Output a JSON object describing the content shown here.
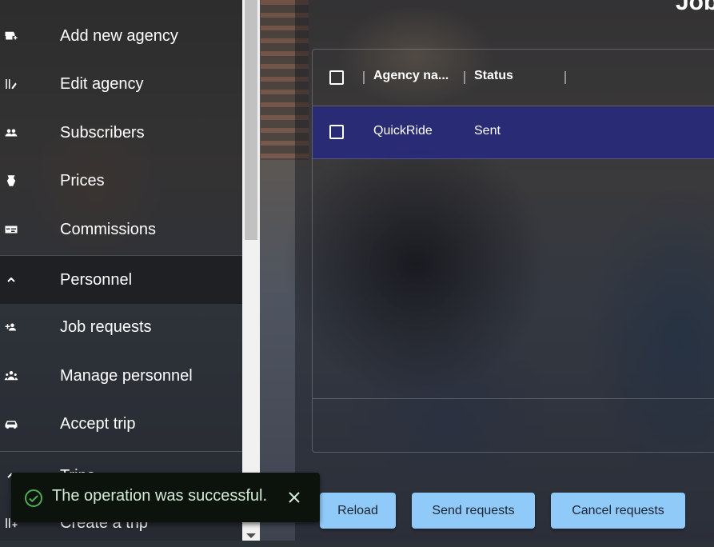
{
  "page": {
    "title": "Job"
  },
  "sidebar": {
    "items": [
      {
        "label": "Add new agency",
        "icon": "add-business-icon"
      },
      {
        "label": "Edit agency",
        "icon": "edit-list-icon"
      },
      {
        "label": "Subscribers",
        "icon": "group-icon"
      },
      {
        "label": "Prices",
        "icon": "price-tag-icon"
      },
      {
        "label": "Commissions",
        "icon": "money-card-icon"
      }
    ],
    "group_personnel": {
      "label": "Personnel",
      "icon": "chevron-up-icon"
    },
    "personnel_items": [
      {
        "label": "Job requests",
        "icon": "person-add-icon"
      },
      {
        "label": "Manage personnel",
        "icon": "people-icon"
      },
      {
        "label": "Accept trip",
        "icon": "car-icon"
      }
    ],
    "group_trips": {
      "label": "Trips",
      "icon": "chevron-up-icon"
    },
    "trip_items": [
      {
        "label": "Create a trip",
        "icon": "playlist-add-icon"
      }
    ]
  },
  "table": {
    "columns": [
      "Agency na...",
      "Status"
    ],
    "rows": [
      {
        "agency": "QuickRide",
        "status": "Sent"
      }
    ]
  },
  "actions": {
    "reload": "Reload",
    "send": "Send requests",
    "cancel": "Cancel requests"
  },
  "snackbar": {
    "message": "The operation was successful."
  },
  "colors": {
    "button_bg": "#90caf9",
    "selected_row": "#26288a",
    "snackbar_bg": "#0c130d",
    "success": "#4caf50"
  }
}
